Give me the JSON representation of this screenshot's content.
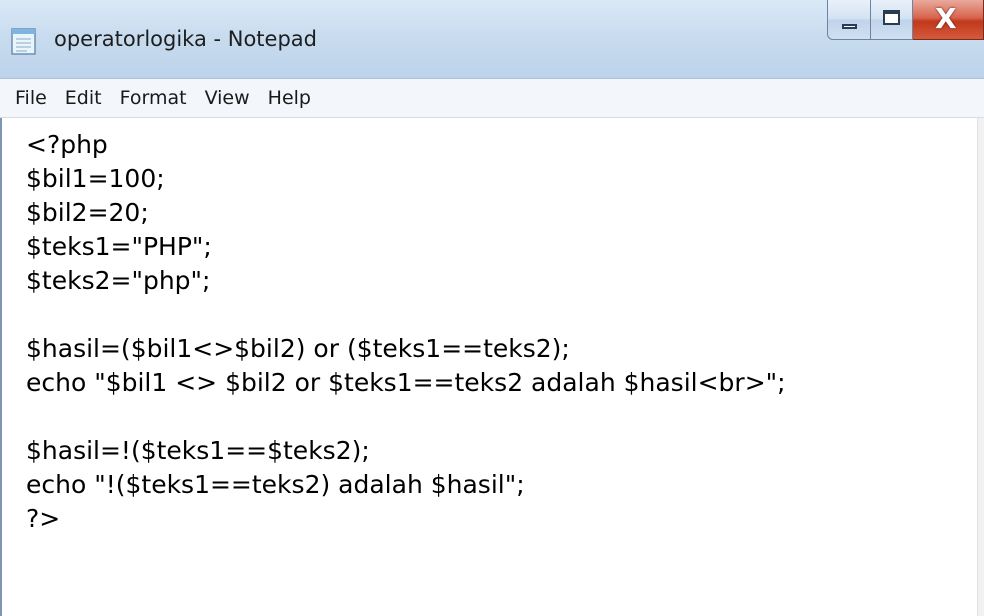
{
  "window": {
    "title": "operatorlogika - Notepad",
    "icon": "notepad-icon",
    "controls": {
      "minimize": "minimize-icon",
      "maximize": "maximize-icon",
      "close_label": "X"
    }
  },
  "menu": {
    "items": [
      {
        "label": "File"
      },
      {
        "label": "Edit"
      },
      {
        "label": "Format"
      },
      {
        "label": "View"
      },
      {
        "label": "Help"
      }
    ]
  },
  "editor": {
    "lines": [
      "<?php",
      "$bil1=100;",
      "$bil2=20;",
      "$teks1=\"PHP\";",
      "$teks2=\"php\";",
      "",
      "$hasil=($bil1<>$bil2) or ($teks1==teks2);",
      "echo \"$bil1 <> $bil2 or $teks1==teks2 adalah $hasil<br>\";",
      "",
      "$hasil=!($teks1==$teks2);",
      "echo \"!($teks1==teks2) adalah $hasil\";",
      "?>"
    ]
  },
  "colors": {
    "titlebar": "#c9dcef",
    "close_button": "#c2381c",
    "text": "#000000"
  }
}
